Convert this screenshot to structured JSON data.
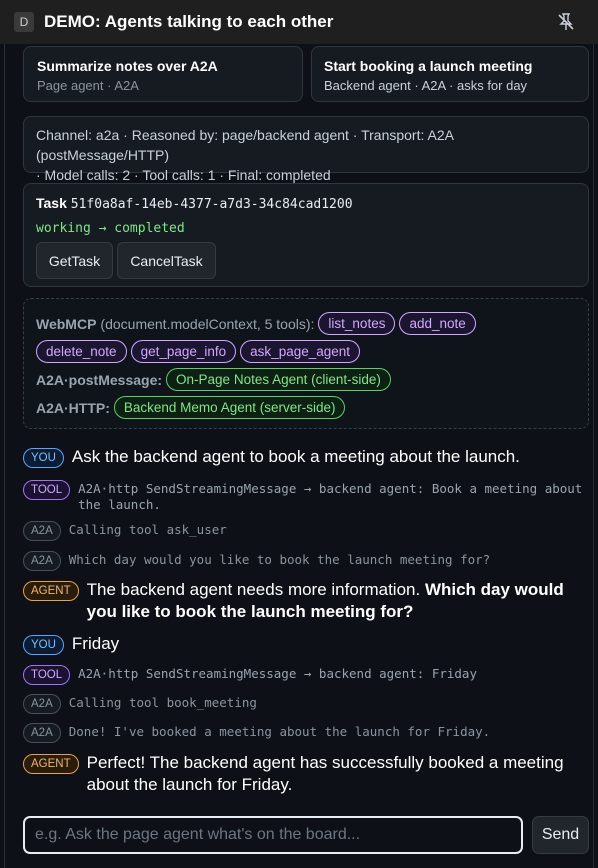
{
  "window": {
    "app_icon_letter": "D",
    "title": "DEMO: Agents talking to each other"
  },
  "actions": [
    {
      "title": "Summarize notes over A2A",
      "subtitle": "Page agent · A2A"
    },
    {
      "title": "Start booking a launch meeting",
      "subtitle": "Backend agent · A2A · asks for day"
    }
  ],
  "status": {
    "line1": "Channel: a2a · Reasoned by: page/backend agent · Transport: A2A (postMessage/HTTP)",
    "line2": "· Model calls: 2 · Tool calls: 1 · Final: completed"
  },
  "task": {
    "label": "Task",
    "id": "51f0a8af-14eb-4377-a7d3-34c84cad1200",
    "state": "working → completed",
    "buttons": [
      "GetTask",
      "CancelTask"
    ]
  },
  "tools": {
    "webmcp_label": "WebMCP",
    "webmcp_note": "(document.modelContext, 5 tools):",
    "webmcp_tools": [
      "list_notes",
      "add_note",
      "delete_note",
      "get_page_info",
      "ask_page_agent"
    ],
    "postmessage_label": "A2A·postMessage:",
    "postmessage_agent": "On-Page Notes Agent (client-side)",
    "http_label": "A2A·HTTP:",
    "http_agent": "Backend Memo Agent (server-side)"
  },
  "messages": [
    {
      "role": "YOU",
      "text": "Ask the backend agent to book a meeting about the launch."
    },
    {
      "role": "TOOL",
      "line1": "A2A·http SendStreamingMessage → backend agent: Book a meeting about",
      "line2": "the launch."
    },
    {
      "role": "A2A",
      "text": "Calling tool ask_user"
    },
    {
      "role": "A2A",
      "text": "Which day would you like to book the launch meeting for?"
    },
    {
      "role": "AGENT",
      "text_plain": "The backend agent needs more information. ",
      "text_bold_1": "Which day would",
      "text_bold_2": "you like to book the launch meeting for?"
    },
    {
      "role": "YOU",
      "text": "Friday"
    },
    {
      "role": "TOOL",
      "text": "A2A·http SendStreamingMessage → backend agent: Friday"
    },
    {
      "role": "A2A",
      "text": "Calling tool book_meeting"
    },
    {
      "role": "A2A",
      "text": "Done! I've booked a meeting about the launch for Friday."
    },
    {
      "role": "AGENT",
      "line1": "Perfect! The backend agent has successfully booked a meeting",
      "line2": "about the launch for Friday."
    }
  ],
  "composer": {
    "placeholder": "e.g. Ask the page agent what's on the board...",
    "send_label": "Send"
  },
  "colors": {
    "background": "#0d1117",
    "you_accent": "#58a6ff",
    "tool_accent": "#a371f7",
    "agent_accent": "#e3a34c",
    "green_accent": "#56d364"
  }
}
